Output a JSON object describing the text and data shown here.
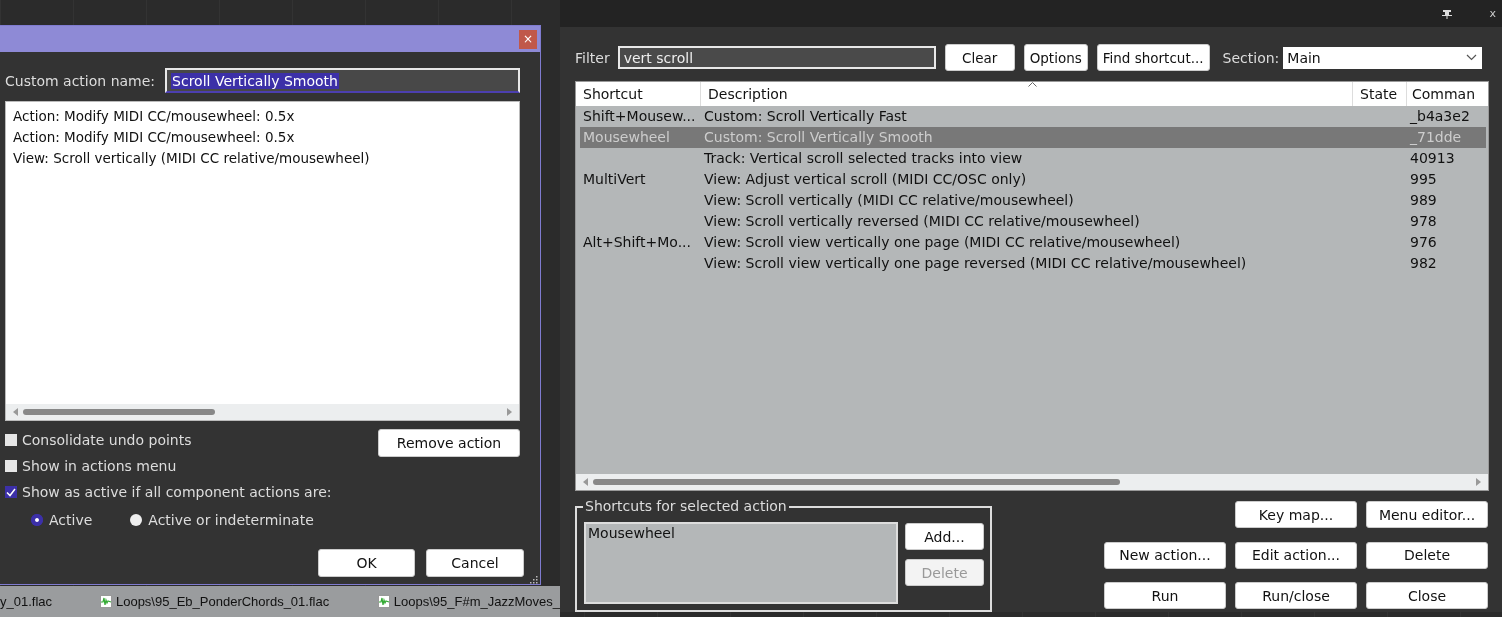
{
  "background": {
    "files": [
      {
        "name": "y_01.flac"
      },
      {
        "name": "Loops\\95_Eb_PonderChords_01.flac"
      },
      {
        "name": "Loops\\95_F#m_JazzMoves_"
      }
    ]
  },
  "custom_action_dialog": {
    "close": "×",
    "name_label": "Custom action name:",
    "name_value": "Scroll Vertically Smooth",
    "actions": [
      "Action: Modify MIDI CC/mousewheel: 0.5x",
      "Action: Modify MIDI CC/mousewheel: 0.5x",
      "View: Scroll vertically (MIDI CC relative/mousewheel)"
    ],
    "remove_button": "Remove action",
    "options": [
      {
        "label": "Consolidate undo points",
        "checked": false
      },
      {
        "label": "Show in actions menu",
        "checked": false
      },
      {
        "label": "Show as active if all component actions are:",
        "checked": true
      }
    ],
    "active_modes": [
      {
        "label": "Active",
        "selected": true
      },
      {
        "label": "Active or indeterminate",
        "selected": false
      }
    ],
    "buttons": [
      "OK",
      "Cancel"
    ]
  },
  "actions_window": {
    "close": "x",
    "filter_label": "Filter",
    "filter_value": "vert scroll",
    "toolbar_buttons": [
      "Clear",
      "Options",
      "Find shortcut..."
    ],
    "section_label": "Section:",
    "section_value": "Main",
    "table": {
      "columns": [
        "Shortcut",
        "Description",
        "State",
        "Comman"
      ],
      "rows": [
        {
          "shortcut": "Shift+Mousew...",
          "description": "Custom: Scroll Vertically Fast",
          "command": "_b4a3e2",
          "selected": false
        },
        {
          "shortcut": "Mousewheel",
          "description": "Custom: Scroll Vertically Smooth",
          "command": "_71dde",
          "selected": true
        },
        {
          "description": "Track: Vertical scroll selected tracks into view",
          "command": "40913",
          "selected": false
        },
        {
          "shortcut": "MultiVert",
          "description": "View: Adjust vertical scroll (MIDI CC/OSC only)",
          "command": "995",
          "selected": false
        },
        {
          "description": "View: Scroll vertically (MIDI CC relative/mousewheel)",
          "command": "989",
          "selected": false
        },
        {
          "description": "View: Scroll vertically reversed (MIDI CC relative/mousewheel)",
          "command": "978",
          "selected": false
        },
        {
          "shortcut": "Alt+Shift+Mo...",
          "description": "View: Scroll view vertically one page (MIDI CC relative/mousewheel)",
          "command": "976",
          "selected": false
        },
        {
          "description": "View: Scroll view vertically one page reversed (MIDI CC relative/mousewheel)",
          "command": "982",
          "selected": false
        }
      ]
    },
    "shortcuts_group": {
      "title": "Shortcuts for selected action",
      "items": [
        "Mousewheel"
      ],
      "buttons": [
        {
          "label": "Add...",
          "disabled": false
        },
        {
          "label": "Delete",
          "disabled": true
        }
      ]
    },
    "action_buttons": [
      {
        "label": "Key map..."
      },
      {
        "label": "Menu editor..."
      },
      {
        "label": "New action..."
      },
      {
        "label": "Edit action..."
      },
      {
        "label": "Delete"
      },
      {
        "label": "Run"
      },
      {
        "label": "Run/close"
      },
      {
        "label": "Close"
      }
    ]
  }
}
